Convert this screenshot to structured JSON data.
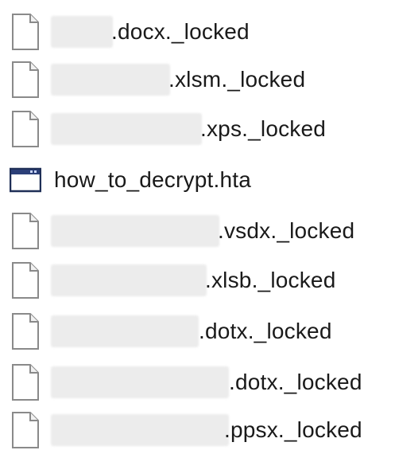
{
  "files": [
    {
      "name": ".docx._locked",
      "icon": "document-icon"
    },
    {
      "name": ".xlsm._locked",
      "icon": "document-icon"
    },
    {
      "name": ".xps._locked",
      "icon": "document-icon"
    },
    {
      "name": "how_to_decrypt.hta",
      "icon": "window-app-icon"
    },
    {
      "name": ".vsdx._locked",
      "icon": "document-icon"
    },
    {
      "name": ".xlsb._locked",
      "icon": "document-icon"
    },
    {
      "name": ".dotx._locked",
      "icon": "document-icon"
    },
    {
      "name": ".dotx._locked",
      "icon": "document-icon"
    },
    {
      "name": ".ppsx._locked",
      "icon": "document-icon"
    }
  ]
}
